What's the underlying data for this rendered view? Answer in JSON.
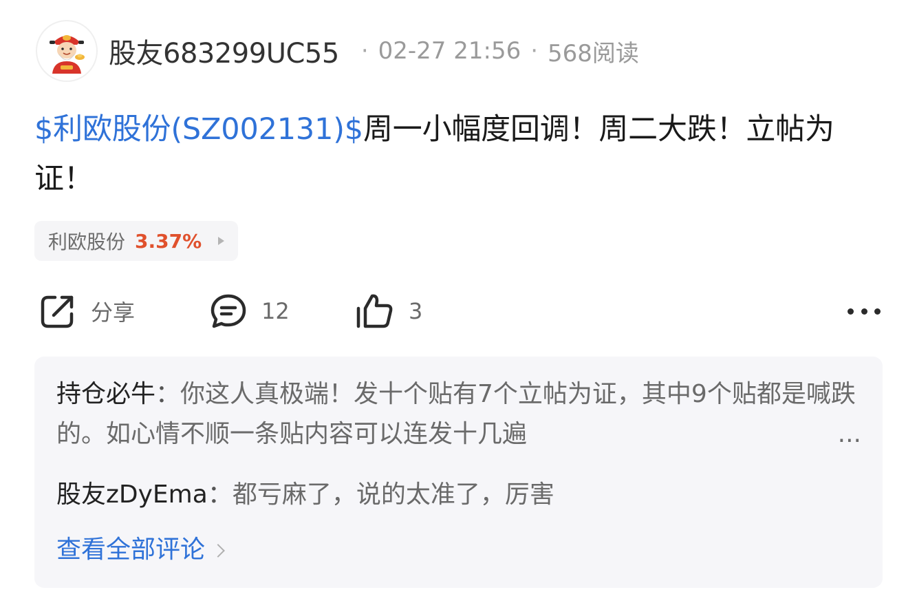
{
  "post": {
    "author": {
      "username": "股友683299UC55"
    },
    "meta": {
      "date": "02-27 21:56",
      "separator": "·",
      "reads": "568阅读"
    },
    "body": {
      "stock_tag": "$利欧股份(SZ002131)$",
      "text": "周一小幅度回调！周二大跌！立帖为证！"
    },
    "stock_chip": {
      "name": "利欧股份",
      "change": "3.37%",
      "change_color": "#e0512d"
    }
  },
  "actions": {
    "share_label": "分享",
    "comment_count": "12",
    "like_count": "3",
    "icons": [
      "share-icon",
      "comment-icon",
      "like-icon",
      "more-icon"
    ]
  },
  "comments": {
    "items": [
      {
        "author": "持仓必牛",
        "colon": "：",
        "text": "你这人真极端！发十个贴有7个立帖为证，其中9个贴都是喊跌的。如心情不顺一条贴内容可以连发十几遍",
        "ellipsis": "..."
      },
      {
        "author": "股友zDyEma",
        "colon": "：",
        "text": "都亏麻了，说的太准了，厉害"
      }
    ],
    "view_all_label": "查看全部评论"
  },
  "colors": {
    "link_blue": "#2f72d8",
    "rise_red": "#e0512d",
    "comment_bg": "#f6f6f9"
  }
}
